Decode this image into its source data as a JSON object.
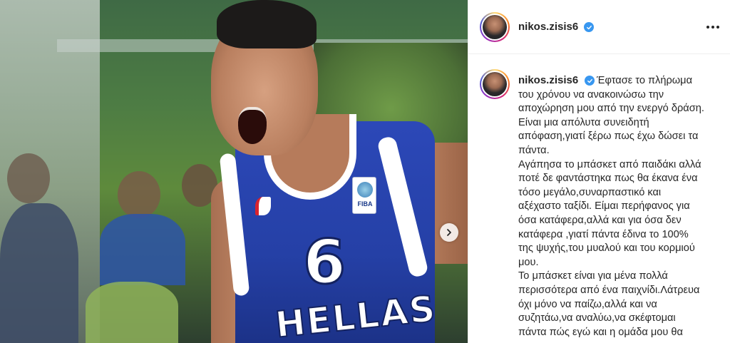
{
  "post": {
    "username": "nikos.zisis6",
    "verified": true,
    "jersey": {
      "number": "6",
      "text": "HELLAS",
      "badge_text": "FIBA"
    },
    "caption_lines": [
      "Έφτασε το πλήρωμα",
      "του χρόνου να ανακοινώσω την",
      "αποχώρηση μου από την ενεργό δράση.",
      "Είναι μια απόλυτα συνειδητή",
      "απόφαση,γιατί ξέρω πως έχω δώσει τα",
      "πάντα.",
      "Αγάπησα το μπάσκετ από παιδάκι αλλά",
      "ποτέ δε φαντάστηκα πως θα έκανα ένα",
      "τόσο μεγάλο,συναρπαστικό και",
      "αξέχαστο ταξίδι. Είμαι περήφανος για",
      "όσα κατάφερα,αλλά και για όσα δεν",
      "κατάφερα ,γιατί πάντα έδινα το 100%",
      "της ψυχής,του μυαλού και του κορμιού",
      "μου.",
      "Το μπάσκετ είναι για μένα πολλά",
      "περισσότερα από ένα παιχνίδι.Λάτρευα",
      "όχι μόνο να παίζω,αλλά και να",
      "συζητάω,να αναλύω,να σκέφτομαι",
      "πάντα πώς εγώ και η ομάδα μου θα"
    ]
  },
  "icons": {
    "verified": "verified-badge-icon",
    "more": "more-options-icon",
    "carousel_next": "chevron-right-icon"
  },
  "colors": {
    "verified_blue": "#3897f0",
    "jersey_blue": "#2540a6",
    "text": "#262626",
    "divider": "#efefef"
  }
}
